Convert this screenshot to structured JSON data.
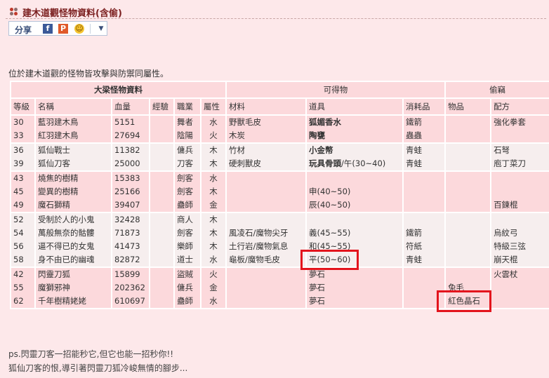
{
  "title": "建木道觀怪物資料(含偷)",
  "share": {
    "label": "分享",
    "icons": [
      "facebook-icon",
      "plurk-icon",
      "smiley-icon",
      "dropdown-icon"
    ]
  },
  "intro": "位於建木道觀的怪物皆攻擊與防禦同屬性。",
  "table": {
    "group_headers": {
      "monster": "大梁怪物資料",
      "drops": "可得物",
      "steal": "偷竊"
    },
    "columns": [
      "等級",
      "名稱",
      "血量",
      "經驗",
      "職業",
      "屬性",
      "材料",
      "道具",
      "消耗品",
      "物品",
      "配方"
    ],
    "groups": [
      {
        "level": [
          "30",
          "33"
        ],
        "name": [
          "藍羽建木鳥",
          "紅羽建木鳥"
        ],
        "hp": [
          "5151",
          "27694"
        ],
        "exp": [],
        "job": [
          "舞者",
          "陰陽"
        ],
        "attr": [
          "水",
          "火"
        ],
        "material": [
          "野獸毛皮",
          "木炭"
        ],
        "item": [
          "狐媚香水",
          "陶甕"
        ],
        "consumable": [
          "鐵箭",
          "蟲蟲"
        ],
        "steal_item": [],
        "recipe": [
          "強化拳套"
        ]
      },
      {
        "level": [
          "36",
          "39"
        ],
        "name": [
          "狐仙戰士",
          "狐仙刀客"
        ],
        "hp": [
          "11382",
          "25000"
        ],
        "exp": [],
        "job": [
          "傭兵",
          "刀客"
        ],
        "attr": [
          "木",
          "木"
        ],
        "material": [
          "竹材",
          "硬刺獸皮"
        ],
        "item": [
          "小金幣",
          "玩具骨頭/午(30~40)"
        ],
        "consumable": [
          "青蛙",
          "青蛙"
        ],
        "steal_item": [],
        "recipe": [
          "石弩",
          "庖丁菜刀"
        ]
      },
      {
        "level": [
          "43",
          "45",
          "49"
        ],
        "name": [
          "燒焦的樹精",
          "變異的樹精",
          "魔石獅精"
        ],
        "hp": [
          "15383",
          "25166",
          "39407"
        ],
        "exp": [],
        "job": [
          "劍客",
          "劍客",
          "蠱師"
        ],
        "attr": [
          "水",
          "木",
          "金"
        ],
        "material": [],
        "item": [
          "",
          "申(40~50)",
          "辰(40~50)"
        ],
        "consumable": [],
        "steal_item": [],
        "recipe": [
          "",
          "",
          "百鍊棍"
        ]
      },
      {
        "level": [
          "52",
          "54",
          "56",
          "58"
        ],
        "name": [
          "受制於人的小鬼",
          "萬般無奈的骷髏",
          "逼不得已的女鬼",
          "身不由已的幽魂"
        ],
        "hp": [
          "32428",
          "71873",
          "41473",
          "82872"
        ],
        "exp": [],
        "job": [
          "商人",
          "劍客",
          "樂師",
          "道士"
        ],
        "attr": [
          "木",
          "木",
          "木",
          "水"
        ],
        "material": [
          "",
          "風凌石/魔物尖牙",
          "土行岩/魔物氣息",
          "龜板/魔物毛皮"
        ],
        "item": [
          "",
          "義(45~55)",
          "和(45~55)",
          "平(50~60)"
        ],
        "consumable": [
          "",
          "鐵箭",
          "符紙",
          "青蛙"
        ],
        "steal_item": [],
        "recipe": [
          "",
          "烏紋弓",
          "特級三弦",
          "崩天棍"
        ]
      },
      {
        "level": [
          "42",
          "55",
          "62"
        ],
        "name": [
          "閃靈刀狐",
          "魔獅邪神",
          "千年樹精姥姥"
        ],
        "hp": [
          "15899",
          "202362",
          "610697"
        ],
        "exp": [],
        "job": [
          "盜賊",
          "傭兵",
          "蠱師"
        ],
        "attr": [
          "火",
          "金",
          "水"
        ],
        "material": [],
        "item": [
          "夢石",
          "夢石",
          "夢石"
        ],
        "consumable": [],
        "steal_item": [
          "",
          "兔毛",
          "紅色晶石"
        ],
        "recipe": [
          "火雲杖"
        ]
      }
    ]
  },
  "footer": {
    "line1": "ps.閃靈刀客一招能秒它,但它也能一招秒你!!",
    "line2": "狐仙刀客的恨,導引著閃靈刀狐冷峻無情的腳步..."
  },
  "colors": {
    "group_a": "#fcd9dc",
    "group_b": "#f6eeee",
    "highlight": "#e3141d",
    "title": "#7b1f1f"
  }
}
